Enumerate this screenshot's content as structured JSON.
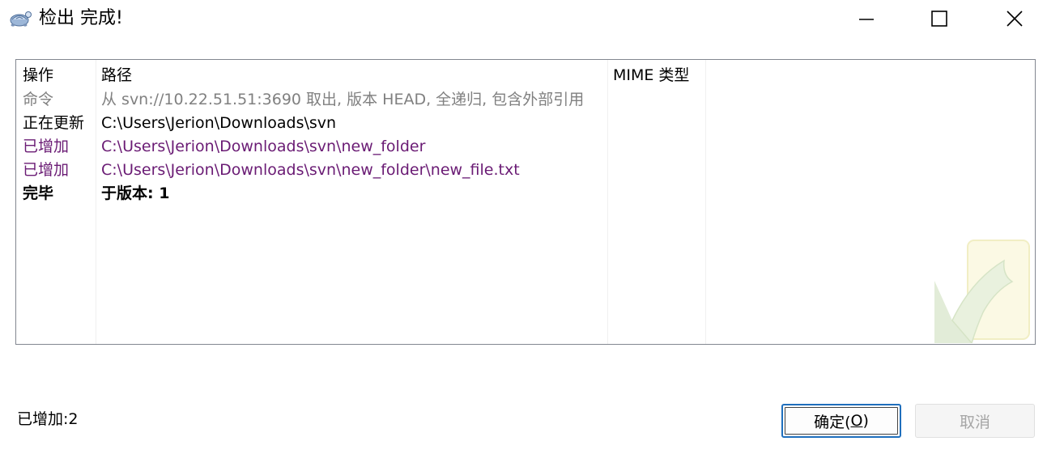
{
  "window": {
    "title": "检出 完成!",
    "app_icon": "tortoisesvn-icon",
    "controls": [
      "minimize-icon",
      "maximize-icon",
      "close-icon"
    ]
  },
  "listview": {
    "columns": [
      "操作",
      "路径",
      "MIME 类型"
    ],
    "rows": [
      {
        "action": "命令",
        "path": "从 svn://10.22.51.51:3690 取出, 版本 HEAD, 全递归, 包含外部引用",
        "style": "gray"
      },
      {
        "action": "正在更新",
        "path": "C:\\Users\\Jerion\\Downloads\\svn",
        "style": "normal"
      },
      {
        "action": "已增加",
        "path": "C:\\Users\\Jerion\\Downloads\\svn\\new_folder",
        "style": "purple"
      },
      {
        "action": "已增加",
        "path": "C:\\Users\\Jerion\\Downloads\\svn\\new_folder\\new_file.txt",
        "style": "purple"
      },
      {
        "action": "完毕",
        "path": "于版本: 1",
        "style": "bold"
      }
    ],
    "watermark_icon": "checkmark-watermark-icon"
  },
  "status": {
    "text": "已增加:2"
  },
  "buttons": {
    "ok_label_prefix": "确定(",
    "ok_label_key": "O",
    "ok_label_suffix": ")",
    "cancel_label": "取消"
  },
  "colors": {
    "gray_text": "#808080",
    "added_text": "#6a1b74",
    "ok_border": "#1f6fbd",
    "disabled_text": "#a6a6a6"
  }
}
